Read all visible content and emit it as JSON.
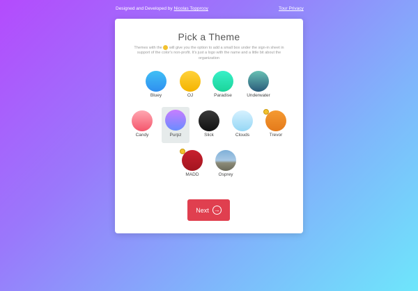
{
  "header": {
    "credit_prefix": "Designed and Developed by",
    "credit_name": "Nicolas Topprcoy",
    "privacy_link": "Tour Privacy"
  },
  "card": {
    "title": "Pick a Theme",
    "description_part1": "Themes with the",
    "description_part2": "will give you the option to add a small box under the sign-in sheet in support of the color's non-profit. It's just a logo with the name and a little bit about the organization",
    "next_label": "Next"
  },
  "themes": [
    {
      "name": "Bluey",
      "color_a": "#40bff5",
      "color_b": "#2f8ff0",
      "badge": false,
      "selected": false
    },
    {
      "name": "OJ",
      "color_a": "#ffd23b",
      "color_b": "#f4b400",
      "badge": false,
      "selected": false
    },
    {
      "name": "Paradise",
      "color_a": "#39f0c8",
      "color_b": "#1bd49a",
      "badge": false,
      "selected": false
    },
    {
      "name": "Underwater",
      "color_a": "#68c1b4",
      "color_b": "#2a5b7a",
      "badge": false,
      "selected": false
    },
    {
      "name": "Candy",
      "color_a": "#ffa7b1",
      "color_b": "#f4566c",
      "badge": false,
      "selected": false
    },
    {
      "name": "Purpz",
      "color_a": "#c77dff",
      "color_b": "#6a8cff",
      "badge": false,
      "selected": true
    },
    {
      "name": "Slick",
      "color_a": "#3a3a3a",
      "color_b": "#111111",
      "badge": false,
      "selected": false
    },
    {
      "name": "Clouds",
      "color_a": "#d6f1ff",
      "color_b": "#95d7f5",
      "badge": false,
      "selected": false
    },
    {
      "name": "Trevor",
      "color_a": "#f59a32",
      "color_b": "#e47a1b",
      "badge": true,
      "selected": false
    },
    {
      "name": "MADD",
      "color_a": "#c8202e",
      "color_b": "#a3151f",
      "badge": true,
      "selected": false
    },
    {
      "name": "Osprey",
      "color_a": "#7fb0d8",
      "color_b": "#6b6a5a",
      "badge": false,
      "selected": false
    }
  ]
}
